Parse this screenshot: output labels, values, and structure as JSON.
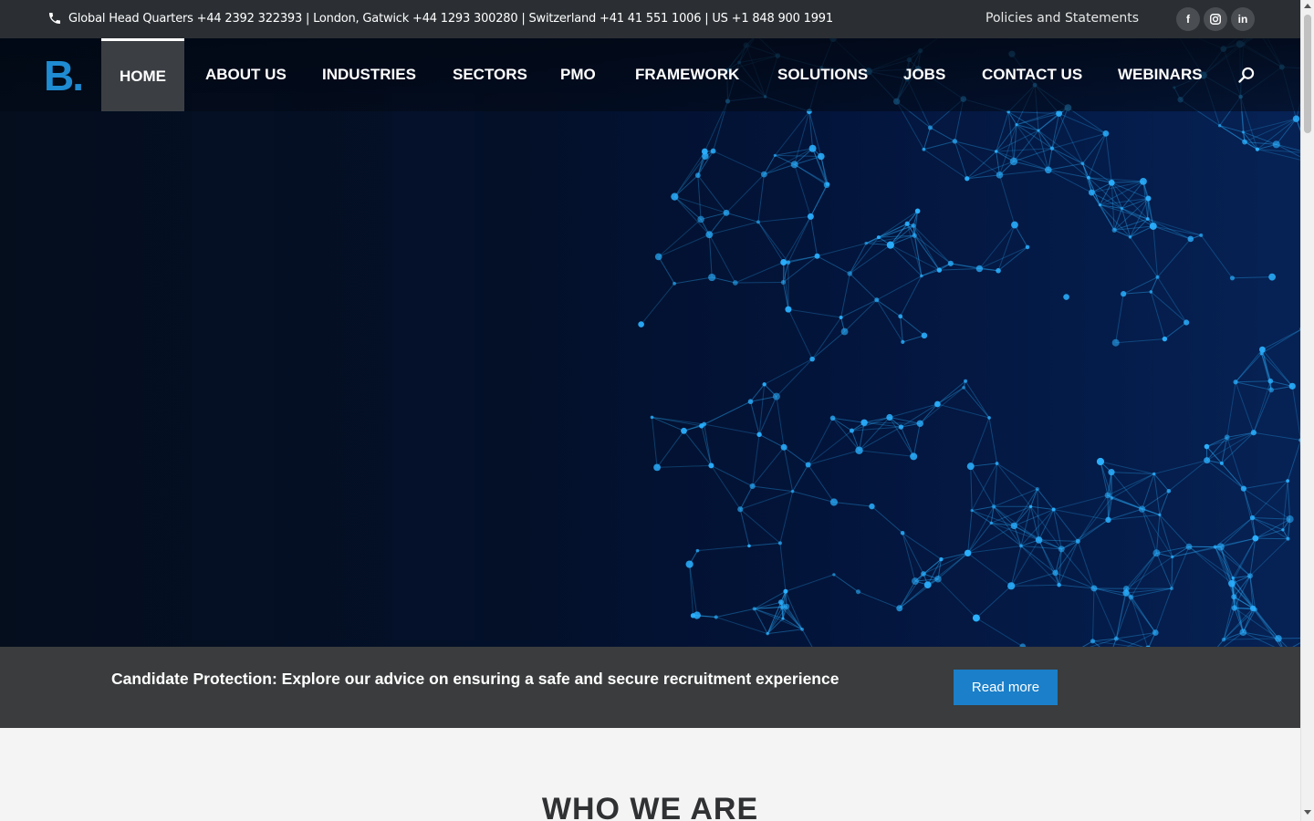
{
  "topbar": {
    "phone_icon": "phone-icon",
    "contact_text": "Global Head Quarters +44 2392 322393 | London, Gatwick +44 1293 300280 | Switzerland +41 41 551 1006 | US +1 848 900 1991",
    "policies_link": "Policies and Statements",
    "social": [
      {
        "icon": "facebook-icon",
        "glyph": "f"
      },
      {
        "icon": "instagram-icon",
        "glyph": "◎"
      },
      {
        "icon": "linkedin-icon",
        "glyph": "in"
      }
    ]
  },
  "nav": {
    "logo_text": "B.",
    "items": [
      {
        "label": "HOME",
        "active": true
      },
      {
        "label": "ABOUT US"
      },
      {
        "label": "INDUSTRIES"
      },
      {
        "label": "SECTORS"
      },
      {
        "label": "PMO"
      },
      {
        "label": "FRAMEWORK"
      },
      {
        "label": "SOLUTIONS"
      },
      {
        "label": "JOBS"
      },
      {
        "label": "CONTACT US"
      },
      {
        "label": "WEBINARS"
      }
    ],
    "search_icon": "search-icon"
  },
  "banner": {
    "message": "Candidate Protection: Explore our advice on ensuring a safe and secure recruitment experience",
    "button_label": "Read more"
  },
  "section": {
    "heading": "WHO WE ARE"
  },
  "colors": {
    "accent": "#1b7fc9",
    "logo": "#1e8bd2",
    "topbar_bg": "#2b2f33",
    "band_bg": "#3a3c3d",
    "hero_bg": "#03102a",
    "network": "#2ab0ff"
  }
}
